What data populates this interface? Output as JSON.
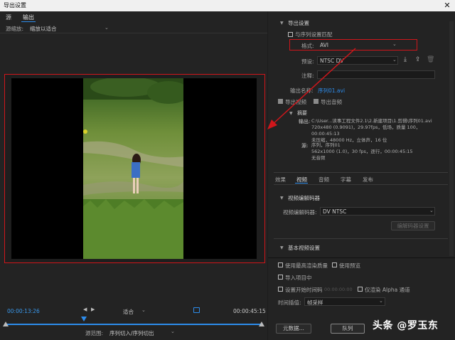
{
  "window": {
    "title": "导出设置"
  },
  "left": {
    "tabs": [
      {
        "label": "源"
      },
      {
        "label": "输出"
      }
    ],
    "source_scale": {
      "label": "源缩放:",
      "value": "缩放以适合"
    },
    "timeline": {
      "current_time": "00:00:13:26",
      "fit_value": "适合",
      "end_time": "00:00:45:15",
      "range_label": "源范围:",
      "range_value": "序列切入/序列切出"
    }
  },
  "export_settings": {
    "section_title": "导出设置",
    "match_sequence_label": "与序列设置匹配",
    "format_label": "格式:",
    "format_value": "AVI",
    "preset_label": "预设:",
    "preset_value": "NTSC DV",
    "comment_label": "注释:",
    "output_name_label": "输出名称:",
    "output_name_value": "序列01.avi",
    "export_video_label": "导出视频",
    "export_audio_label": "导出音频",
    "summary": {
      "title": "摘要",
      "output_label": "输出:",
      "output_lines": [
        "C:\\User...读事工程文件2.1\\2.新建项目\\1.剪辑\\序列01.avi",
        "720x480 (0.9091)，29.97fps，低场，质量 100，00:00:45:13",
        "未压缩，48000 Hz，立体声，16 位"
      ],
      "source_label": "源:",
      "source_lines": [
        "序列，序列01",
        "562x1000 (1.0)，30 fps，逐行，00:00:45:15",
        "无音频"
      ]
    }
  },
  "settings_tabs": [
    {
      "label": "效果"
    },
    {
      "label": "视频"
    },
    {
      "label": "音频"
    },
    {
      "label": "字幕"
    },
    {
      "label": "发布"
    }
  ],
  "video_codec": {
    "section_title": "视频编解码器",
    "codec_label": "视频编解码器:",
    "codec_value": "DV NTSC",
    "codec_settings_button": "编解码器设置"
  },
  "basic_video": {
    "section_title": "基本视频设置"
  },
  "bottom_options": {
    "max_render_quality": "使用最高渲染质量",
    "use_previews": "使用预览",
    "import_into_project": "导入项目中",
    "set_start_timecode": "设置开始时间码",
    "start_timecode_value": "00:00:00:00",
    "render_alpha_only": "仅渲染 Alpha 通道",
    "time_interpolation_label": "时间插值:",
    "time_interpolation_value": "帧采样"
  },
  "buttons": {
    "metadata": "元数据...",
    "queue": "队列"
  },
  "watermark": {
    "text": "头条 @罗玉东"
  },
  "colors": {
    "accent_blue": "#2d8ceb",
    "highlight_red": "#d0161b",
    "panel_bg": "#232323"
  }
}
